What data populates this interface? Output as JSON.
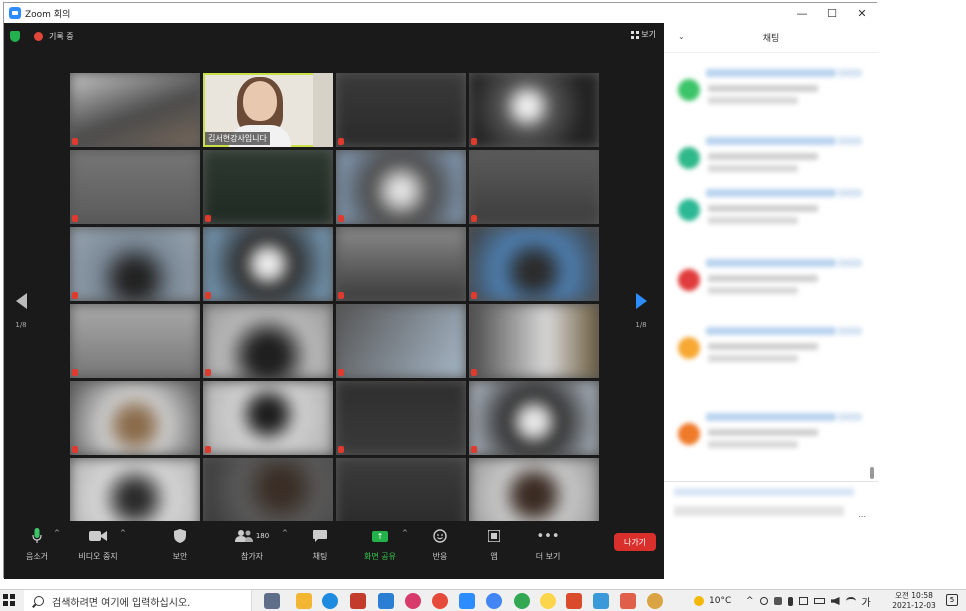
{
  "window": {
    "title": "Zoom 회의",
    "controls": {
      "minimize": "—",
      "maximize": "☐",
      "close": "✕"
    }
  },
  "meeting": {
    "recording_label": "기록 중",
    "view_label": "보기",
    "active_speaker_name": "김서현강사입니다",
    "page_left": "1/8",
    "page_right": "1/8"
  },
  "toolbar": {
    "audio_label": "음소거",
    "video_label": "비디오 중지",
    "security_label": "보안",
    "participants_label": "참가자",
    "participants_count": "180",
    "chat_label": "채팅",
    "share_label": "화면 공유",
    "reactions_label": "반응",
    "apps_label": "앱",
    "more_label": "더 보기",
    "leave_label": "나가기"
  },
  "chat": {
    "title": "채팅",
    "more_glyph": "...",
    "avatar_colors": [
      "#3cc468",
      "#2fb88a",
      "#2cb894",
      "#e03c3c",
      "#f7a833",
      "#ef7a2a"
    ]
  },
  "taskbar": {
    "search_placeholder": "검색하려면 여기에 입력하십시오.",
    "weather": "10°C",
    "ime": "가",
    "time": "오전 10:58",
    "date": "2021-12-03",
    "notifications": "5",
    "app_colors": [
      "#5f6f8a",
      "#f2b632",
      "#1d8be0",
      "#c23b2b",
      "#2a7fd4",
      "#d83b6b",
      "#e64a3b",
      "#2d8cff",
      "#4285f4",
      "#33a853",
      "#fcd64a",
      "#d94b2b",
      "#3a9ad9",
      "#e05f4a",
      "#d9a441"
    ]
  }
}
